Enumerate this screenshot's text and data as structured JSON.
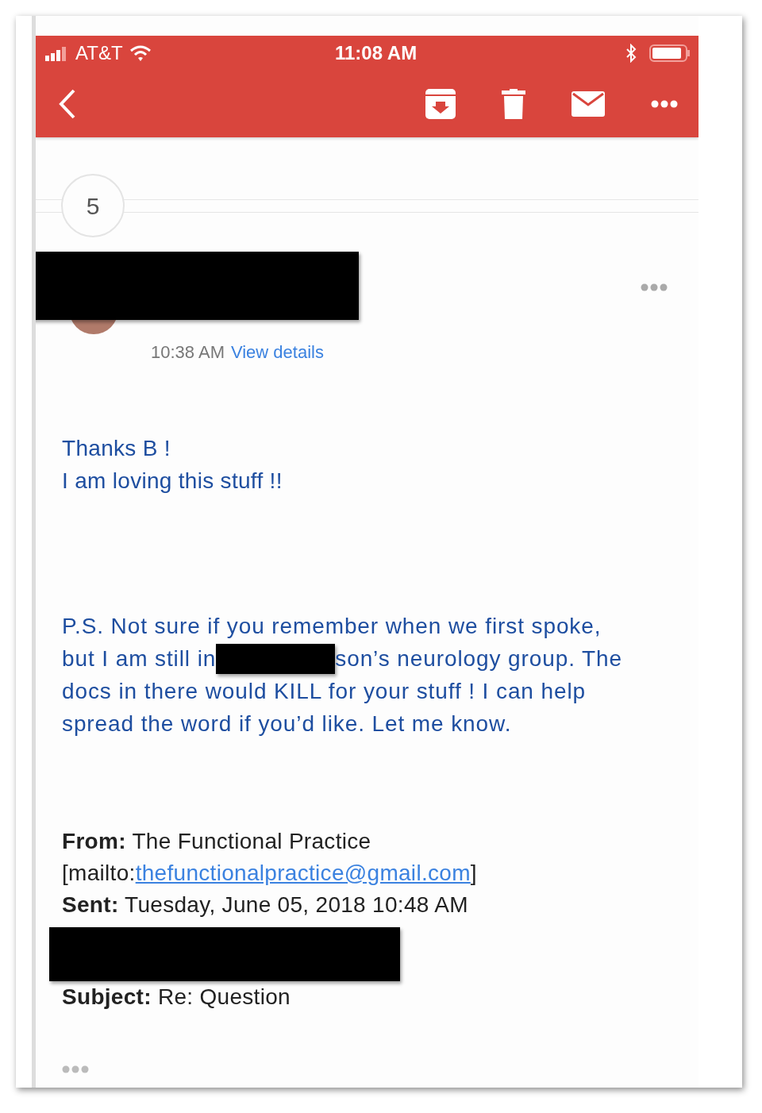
{
  "status_bar": {
    "carrier": "AT&T",
    "time": "11:08 AM"
  },
  "collapsed_count": "5",
  "message": {
    "time": "10:38 AM",
    "details_link": "View details",
    "greeting": [
      "Thanks B !",
      "I am loving this stuff !!"
    ],
    "ps_lines": [
      {
        "kind": "text",
        "text": "P.S. Not sure if you remember when we first spoke,"
      },
      {
        "kind": "redacted",
        "before": "but I am still in",
        "after": "son’s neurology group. The"
      },
      {
        "kind": "text",
        "text": "docs in there would KILL for your stuff ! I can help"
      },
      {
        "kind": "text",
        "text": "spread the word if you’d like. Let me know."
      }
    ],
    "quoted_from": "**From:** The Functional Practice",
    "mailto_open": "[mailto:",
    "email": "thefunctionalpractice@gmail.com",
    "mailto_close": "]",
    "quoted_sent": "**Sent:** Tuesday, June 05, 2018 10:48 AM",
    "quoted_subject": "**Subject:** Re: Question"
  }
}
